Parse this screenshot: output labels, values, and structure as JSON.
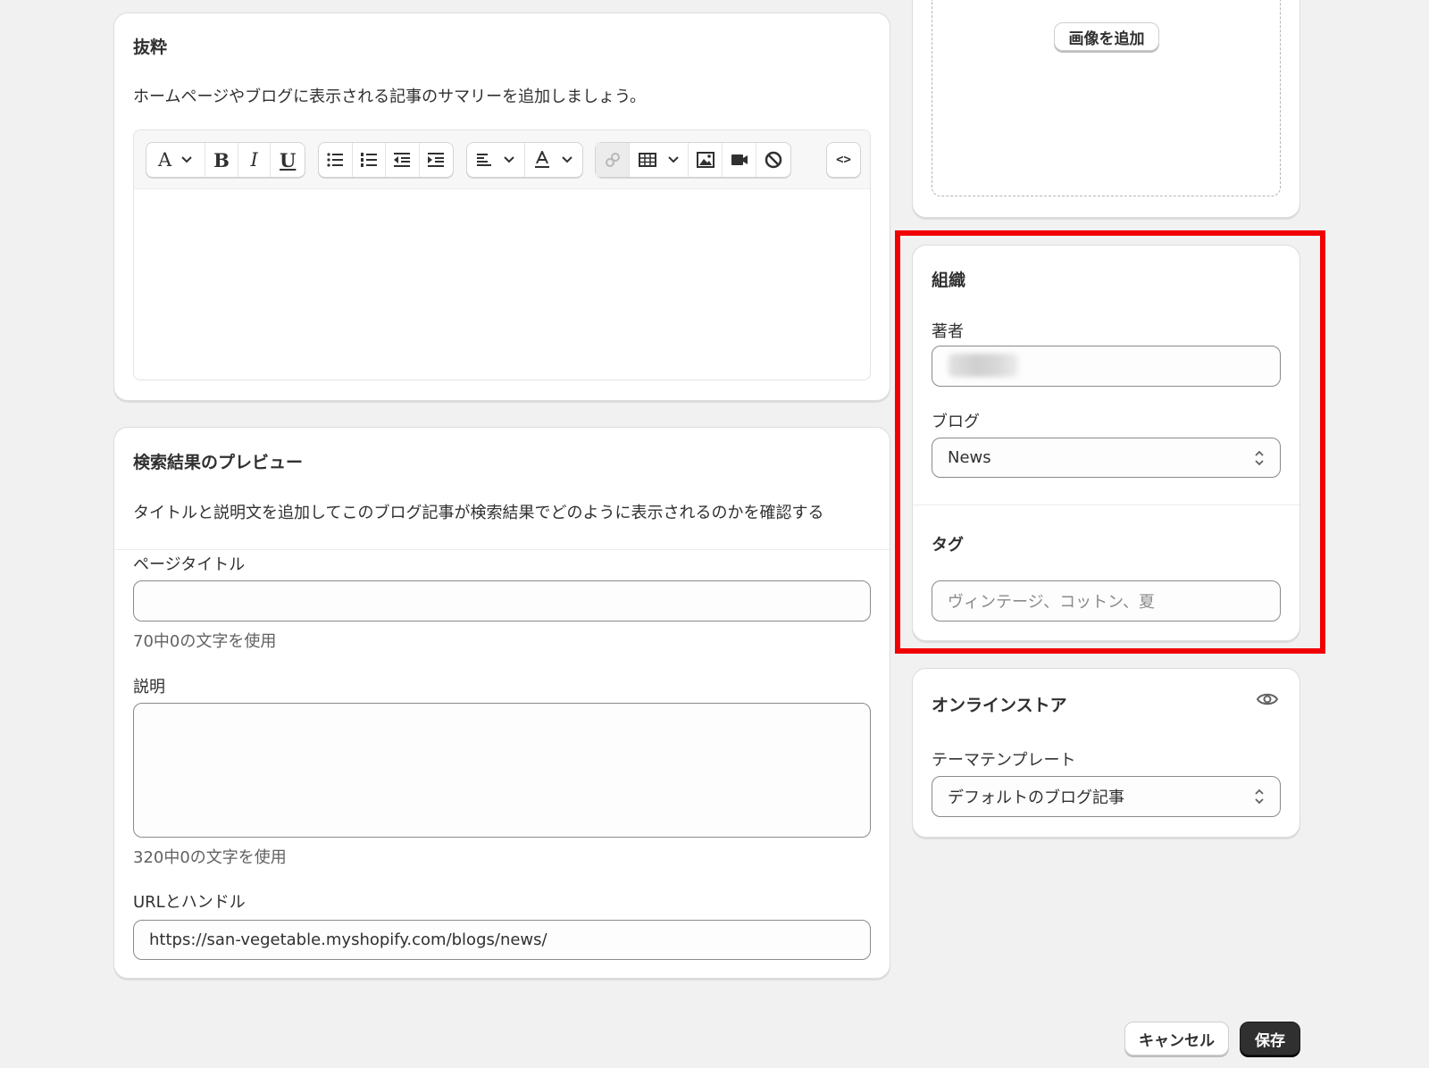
{
  "excerpt": {
    "title": "抜粋",
    "description": "ホームページやブログに表示される記事のサマリーを追加しましょう。",
    "toolbar": {
      "font_label": "A",
      "bold_label": "B",
      "italic_label": "I",
      "underline_label": "U",
      "code_label": "<>"
    }
  },
  "seo": {
    "title": "検索結果のプレビュー",
    "description": "タイトルと説明文を追加してこのブログ記事が検索結果でどのように表示されるのかを確認する",
    "page_title_label": "ページタイトル",
    "page_title_value": "",
    "page_title_help": "70中0の文字を使用",
    "meta_label": "説明",
    "meta_value": "",
    "meta_help": "320中0の文字を使用",
    "url_label": "URLとハンドル",
    "url_value": "https://san-vegetable.myshopify.com/blogs/news/"
  },
  "image": {
    "add_button": "画像を追加"
  },
  "organization": {
    "title": "組織",
    "author_label": "著者",
    "blog_label": "ブログ",
    "blog_value": "News",
    "tags_title": "タグ",
    "tags_placeholder": "ヴィンテージ、コットン、夏"
  },
  "online_store": {
    "title": "オンラインストア",
    "template_label": "テーマテンプレート",
    "template_value": "デフォルトのブログ記事"
  },
  "footer": {
    "cancel": "キャンセル",
    "save": "保存"
  },
  "colors": {
    "highlight": "#f00000",
    "primary_button": "#303030",
    "background": "#f1f1f1"
  }
}
